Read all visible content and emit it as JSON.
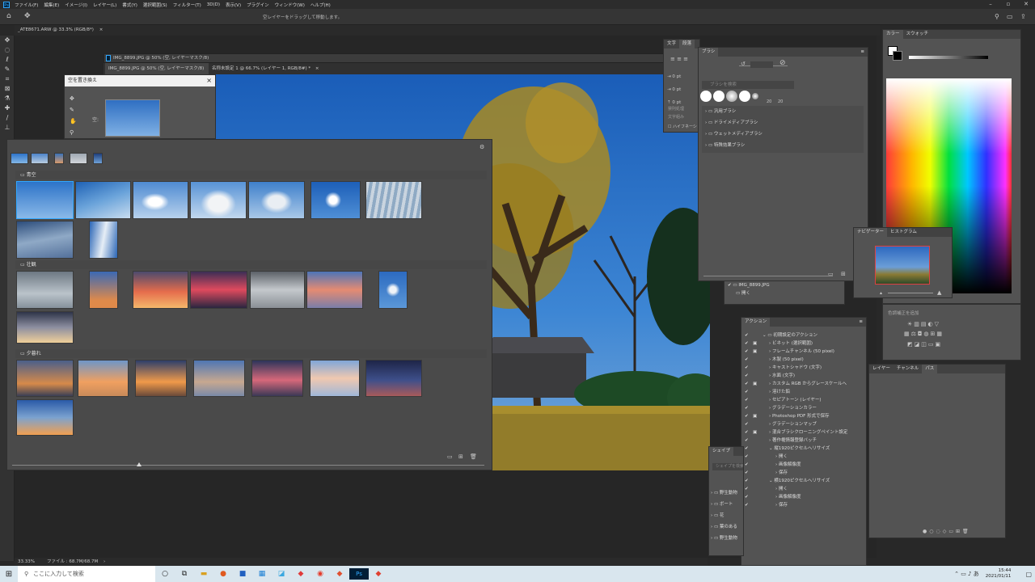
{
  "app": {
    "logo": "Ps"
  },
  "menu": [
    "ファイル(F)",
    "編集(E)",
    "イメージ(I)",
    "レイヤー(L)",
    "書式(Y)",
    "選択範囲(S)",
    "フィルター(T)",
    "3D(D)",
    "表示(V)",
    "プラグイン",
    "ウィンドウ(W)",
    "ヘルプ(H)"
  ],
  "options": {
    "hint": "空レイヤーをドラッグして移動します。"
  },
  "tabs": {
    "doc1": "_ATE8671.ARW @ 33.3% (RGB/8*)",
    "doc1_close": "×",
    "doc2": "IMG_8899.JPG @ 50% (空, レイヤーマスク/8)",
    "doc2b": "IMG_8899.JPG @ 50% (空, レイヤーマスク/8)",
    "doc2b_close": "×",
    "doc3": "名称未設定 1 @ 66.7% (レイヤー 1, RGB/8#) *",
    "doc3_close": "×"
  },
  "sky_dialog": {
    "title": "空を置き換え",
    "close": "×",
    "sky_label": "空:"
  },
  "sky_presets": {
    "categories": [
      "青空",
      "壮観",
      "夕暮れ"
    ],
    "gear": "⚙"
  },
  "char_panel": {
    "tabs": [
      "文字",
      "段落"
    ],
    "values": [
      "0 pt",
      "0 pt",
      "0 pt"
    ],
    "l1": "禁則処理",
    "l2": "文字組み",
    "hyphen": "ハイフネーション"
  },
  "brush_panel": {
    "tab": "ブラシ",
    "search_placeholder": "ブラシを検索",
    "sizes": [
      "20",
      "20"
    ],
    "folders": [
      "汎用ブラシ",
      "ドライメディアブラシ",
      "ウェットメディアブラシ",
      "特殊効果ブラシ"
    ]
  },
  "navigator": {
    "tabs": [
      "ナビゲーター",
      "ヒストグラム"
    ]
  },
  "history": {
    "item1": "IMG_8899.JPG",
    "item2": "開く"
  },
  "actions": {
    "tab": "アクション",
    "items": [
      {
        "label": "初期設定のアクション",
        "level": 0,
        "open": true,
        "dialog": false
      },
      {
        "label": "ビネット (選択範囲)",
        "level": 1,
        "dialog": true
      },
      {
        "label": "フレームチャンネル (50 pixel)",
        "level": 1,
        "dialog": true
      },
      {
        "label": "木製 (50 pixel)",
        "level": 1,
        "dialog": false
      },
      {
        "label": "キャストシャドウ (文字)",
        "level": 1,
        "dialog": false
      },
      {
        "label": "水面 (文字)",
        "level": 1,
        "dialog": false
      },
      {
        "label": "カスタム RGB からグレースケールへ",
        "level": 1,
        "dialog": true
      },
      {
        "label": "溶けた鉛",
        "level": 1,
        "dialog": false
      },
      {
        "label": "セピアトーン (レイヤー)",
        "level": 1,
        "dialog": false
      },
      {
        "label": "グラデーションカラー",
        "level": 1,
        "dialog": false
      },
      {
        "label": "Photoshop PDF 形式で保存",
        "level": 1,
        "dialog": true
      },
      {
        "label": "グラデーションマップ",
        "level": 1,
        "dialog": false
      },
      {
        "label": "混合ブラシクローニングペイント設定",
        "level": 1,
        "dialog": true
      },
      {
        "label": "著作権情報登録バッチ",
        "level": 1,
        "dialog": false
      },
      {
        "label": "縦1920ピクセルへリサイズ",
        "level": 1,
        "open": true,
        "dialog": false
      },
      {
        "label": "開く",
        "level": 2,
        "dialog": false
      },
      {
        "label": "画像解像度",
        "level": 2,
        "dialog": false
      },
      {
        "label": "保存",
        "level": 2,
        "dialog": false
      },
      {
        "label": "横1920ピクセルへリサイズ",
        "level": 1,
        "open": true,
        "dialog": false
      },
      {
        "label": "開く",
        "level": 2,
        "dialog": false
      },
      {
        "label": "画像解像度",
        "level": 2,
        "dialog": false
      },
      {
        "label": "保存",
        "level": 2,
        "dialog": false
      }
    ]
  },
  "shapes": {
    "tab": "シェイプ",
    "search_placeholder": "シェイプを検索",
    "folders": [
      "野生動物",
      "ボート",
      "花",
      "葉のある",
      "野生動物"
    ]
  },
  "color_panel": {
    "tabs": [
      "カラー",
      "スウォッチ"
    ]
  },
  "adjust": {
    "label": "色調補正を追加"
  },
  "layers_panel": {
    "tabs": [
      "レイヤー",
      "チャンネル",
      "パス"
    ]
  },
  "status": {
    "zoom": "33.33%",
    "file": "ファイル : 68.7M/68.7M"
  },
  "taskbar": {
    "search_placeholder": "ここに入力して検索",
    "time": "15:44",
    "date": "2021/01/11"
  },
  "colors": {
    "accent": "#31a8ff",
    "bg": "#282828",
    "panel": "#535353"
  }
}
